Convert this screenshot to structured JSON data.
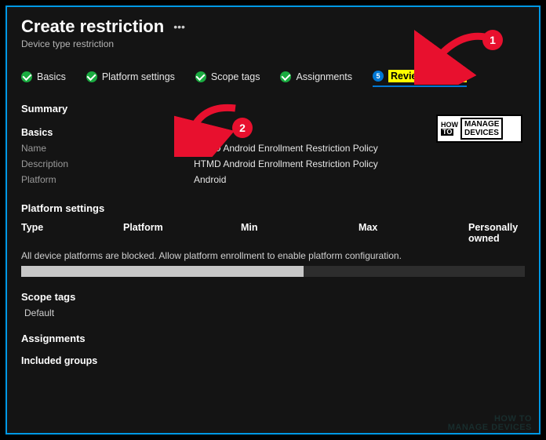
{
  "header": {
    "title": "Create restriction",
    "subtitle": "Device type restriction"
  },
  "tabs": {
    "basics": "Basics",
    "platform_settings": "Platform settings",
    "scope_tags": "Scope tags",
    "assignments": "Assignments",
    "review_create": "Review + create",
    "review_step_num": "5"
  },
  "summary": {
    "heading": "Summary",
    "basics_heading": "Basics",
    "name_label": "Name",
    "name_value": "HTMD Android Enrollment Restriction Policy",
    "description_label": "Description",
    "description_value": "HTMD Android Enrollment Restriction Policy",
    "platform_label": "Platform",
    "platform_value": "Android"
  },
  "platform_settings": {
    "heading": "Platform settings",
    "cols": {
      "type": "Type",
      "platform": "Platform",
      "min": "Min",
      "max": "Max",
      "personally": "Personally owned"
    },
    "message": "All device platforms are blocked. Allow platform enrollment to enable platform configuration."
  },
  "scope_tags": {
    "heading": "Scope tags",
    "value": "Default"
  },
  "assignments": {
    "heading": "Assignments",
    "included_heading": "Included groups"
  },
  "annotations": {
    "badge1": "1",
    "badge2": "2"
  },
  "logo": {
    "how": "HOW",
    "to": "TO",
    "manage": "MANAGE",
    "devices": "DEVICES"
  },
  "watermark": {
    "l1": "HOW TO",
    "l2": "MANAGE DEVICES"
  }
}
